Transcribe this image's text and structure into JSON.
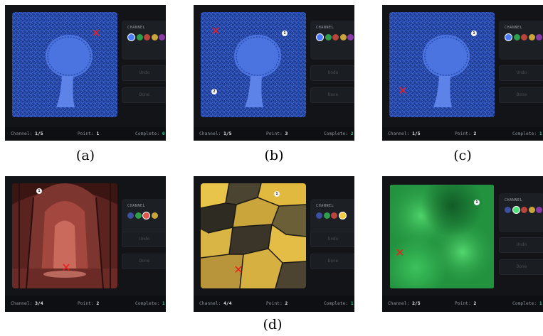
{
  "channel_header": "CHANNEL",
  "undo_label": "Undo",
  "done_label": "Done",
  "status_labels": {
    "channel": "Channel:",
    "point": "Point:",
    "complete": "Complete:"
  },
  "colors": {
    "blue": "#4e7cff",
    "green": "#2e9e4e",
    "red": "#b9443b",
    "yellow": "#c9a53b",
    "purple": "#8b3aa8"
  },
  "panels": [
    {
      "caption": "(a)",
      "channel": "1/5",
      "point": "1",
      "complete": "0",
      "badge": ""
    },
    {
      "caption": "(b)",
      "channel": "1/5",
      "point": "3",
      "complete": "2",
      "badge": "1",
      "badge2": "2"
    },
    {
      "caption": "(c)",
      "channel": "1/5",
      "point": "2",
      "complete": "1",
      "badge": "1"
    },
    {
      "channel": "3/4",
      "point": "2",
      "complete": "1",
      "badge": "1"
    },
    {
      "channel": "4/4",
      "point": "2",
      "complete": "1",
      "badge": "1"
    },
    {
      "channel": "2/5",
      "point": "2",
      "complete": "1",
      "badge": "1"
    }
  ],
  "group_caption": "(d)",
  "cross_symbol": "✕"
}
